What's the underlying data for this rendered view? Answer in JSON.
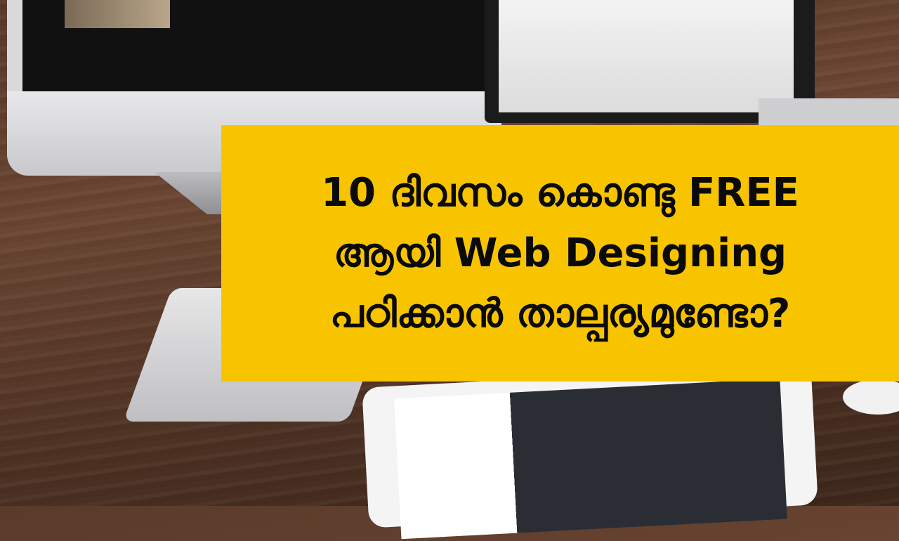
{
  "banner": {
    "background_color": "#f8c400",
    "text_color": "#0a0a0a",
    "lines": [
      "10 ദിവസം കൊണ്ടു FREE",
      "ആയി Web Designing",
      "പഠിക്കാൻ താല്പര്യമുണ്ടോ?"
    ]
  },
  "background": {
    "scene": [
      "imac",
      "laptop",
      "keyboard",
      "tablet",
      "mouse",
      "wooden-desk"
    ]
  }
}
